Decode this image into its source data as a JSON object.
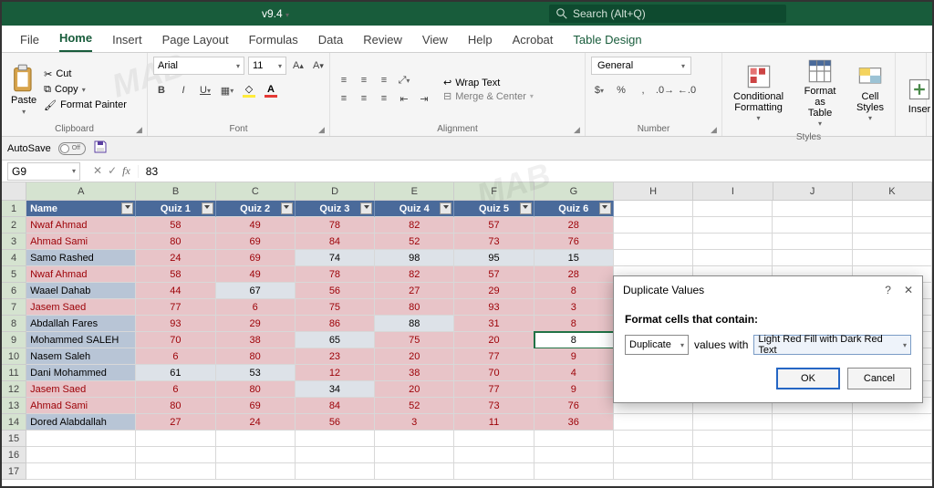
{
  "titlebar": {
    "version": "v9.4",
    "search_placeholder": "Search (Alt+Q)"
  },
  "menu": {
    "tabs": [
      "File",
      "Home",
      "Insert",
      "Page Layout",
      "Formulas",
      "Data",
      "Review",
      "View",
      "Help",
      "Acrobat",
      "Table Design"
    ]
  },
  "ribbon": {
    "paste": "Paste",
    "cut": "Cut",
    "copy": "Copy",
    "format_painter": "Format Painter",
    "clipboard": "Clipboard",
    "font_name": "Arial",
    "font_size": "11",
    "font": "Font",
    "wrap": "Wrap Text",
    "merge": "Merge & Center",
    "alignment": "Alignment",
    "number_format": "General",
    "number": "Number",
    "cond_fmt": "Conditional\nFormatting",
    "fmt_table": "Format as\nTable",
    "cell_styles": "Cell\nStyles",
    "styles": "Styles",
    "insert": "Inser"
  },
  "autosave": {
    "label": "AutoSave",
    "state": "Off"
  },
  "formula": {
    "namebox": "G9",
    "value": "83"
  },
  "columns": [
    "A",
    "B",
    "C",
    "D",
    "E",
    "F",
    "G",
    "H",
    "I",
    "J",
    "K"
  ],
  "table": {
    "headers": [
      "Name",
      "Quiz 1",
      "Quiz 2",
      "Quiz 3",
      "Quiz 4",
      "Quiz 5",
      "Quiz 6"
    ],
    "rows": [
      {
        "n": "Nwaf Ahmad",
        "v": [
          58,
          49,
          78,
          82,
          57,
          28
        ],
        "nameDup": true,
        "cellDup": [
          true,
          true,
          true,
          true,
          true,
          true
        ]
      },
      {
        "n": "Ahmad Sami",
        "v": [
          80,
          69,
          84,
          52,
          73,
          76
        ],
        "nameDup": true,
        "cellDup": [
          true,
          true,
          true,
          true,
          true,
          true
        ]
      },
      {
        "n": "Samo Rashed",
        "v": [
          24,
          69,
          74,
          98,
          95,
          15
        ],
        "nameDup": false,
        "cellDup": [
          true,
          true,
          false,
          false,
          false,
          false
        ]
      },
      {
        "n": "Nwaf Ahmad",
        "v": [
          58,
          49,
          78,
          82,
          57,
          28
        ],
        "nameDup": true,
        "cellDup": [
          true,
          true,
          true,
          true,
          true,
          true
        ]
      },
      {
        "n": "Waael Dahab",
        "v": [
          44,
          67,
          56,
          27,
          29,
          8
        ],
        "nameDup": false,
        "cellDup": [
          true,
          false,
          true,
          true,
          true,
          true
        ]
      },
      {
        "n": "Jasem Saed",
        "v": [
          77,
          6,
          75,
          80,
          93,
          3
        ],
        "nameDup": true,
        "cellDup": [
          true,
          true,
          true,
          true,
          true,
          true
        ]
      },
      {
        "n": "Abdallah Fares",
        "v": [
          93,
          29,
          86,
          88,
          31,
          8
        ],
        "nameDup": false,
        "cellDup": [
          true,
          true,
          true,
          false,
          true,
          true
        ]
      },
      {
        "n": "Mohammed SALEH",
        "v": [
          70,
          38,
          65,
          75,
          20,
          8
        ],
        "nameDup": false,
        "cellDup": [
          true,
          true,
          false,
          true,
          true,
          "active"
        ]
      },
      {
        "n": "Nasem Saleh",
        "v": [
          6,
          80,
          23,
          20,
          77,
          9
        ],
        "nameDup": false,
        "cellDup": [
          true,
          true,
          true,
          true,
          true,
          true
        ]
      },
      {
        "n": "Dani Mohammed",
        "v": [
          61,
          53,
          12,
          38,
          70,
          4
        ],
        "nameDup": false,
        "cellDup": [
          false,
          false,
          true,
          true,
          true,
          true
        ]
      },
      {
        "n": "Jasem Saed",
        "v": [
          6,
          80,
          34,
          20,
          77,
          9
        ],
        "nameDup": true,
        "cellDup": [
          true,
          true,
          false,
          true,
          true,
          true
        ]
      },
      {
        "n": "Ahmad Sami",
        "v": [
          80,
          69,
          84,
          52,
          73,
          76
        ],
        "nameDup": true,
        "cellDup": [
          true,
          true,
          true,
          true,
          true,
          true
        ]
      },
      {
        "n": "Dored Alabdallah",
        "v": [
          27,
          24,
          56,
          3,
          11,
          36
        ],
        "nameDup": false,
        "cellDup": [
          true,
          true,
          true,
          true,
          true,
          true
        ]
      }
    ]
  },
  "dialog": {
    "title": "Duplicate Values",
    "label": "Format cells that contain:",
    "mode": "Duplicate",
    "middle": "values with",
    "style": "Light Red Fill with Dark Red Text",
    "ok": "OK",
    "cancel": "Cancel"
  },
  "watermark": "MAB"
}
